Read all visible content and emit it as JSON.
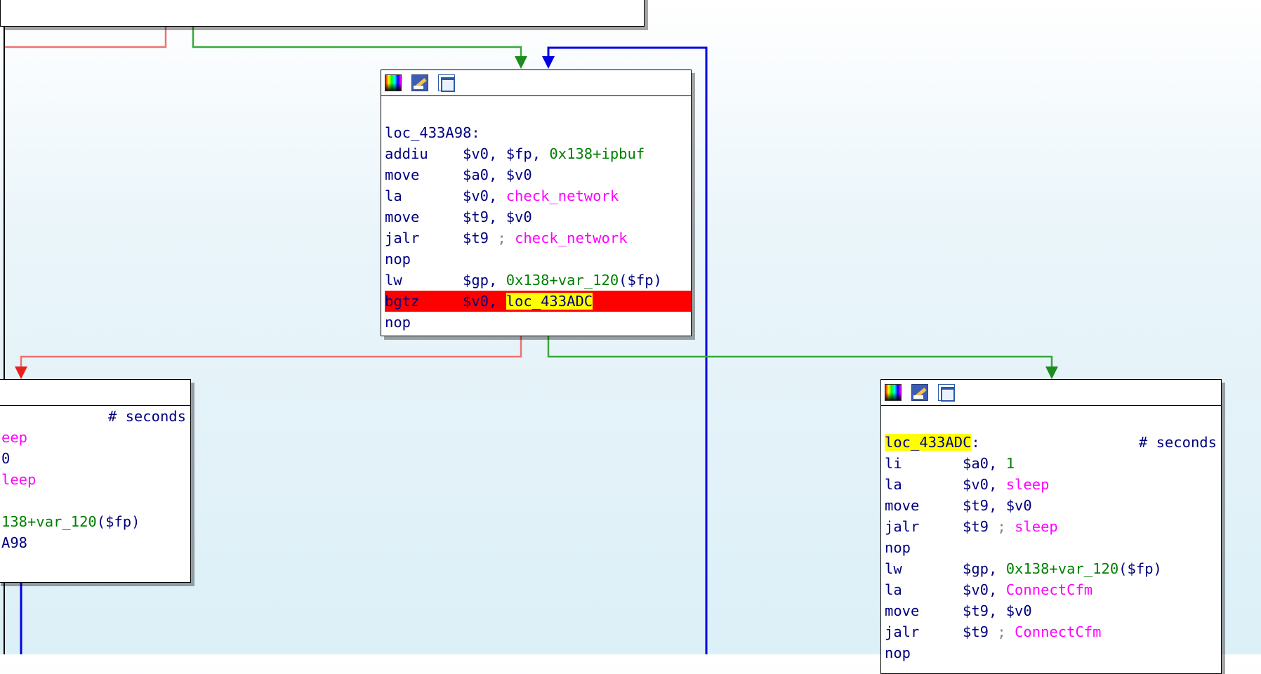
{
  "nodes": {
    "center": {
      "lines": [
        {
          "label": "loc_433A98:"
        },
        {
          "op": "addiu",
          "args": [
            {
              "t": "$v0, $fp, ",
              "c": "navy"
            },
            {
              "t": "0x138+ipbuf",
              "c": "grn"
            }
          ]
        },
        {
          "op": "move",
          "args": [
            {
              "t": "$a0, $v0",
              "c": "navy"
            }
          ]
        },
        {
          "op": "la",
          "args": [
            {
              "t": "$v0, ",
              "c": "navy"
            },
            {
              "t": "check_network",
              "c": "mag"
            }
          ]
        },
        {
          "op": "move",
          "args": [
            {
              "t": "$t9, $v0",
              "c": "navy"
            }
          ]
        },
        {
          "op": "jalr",
          "args": [
            {
              "t": "$t9 ",
              "c": "navy"
            },
            {
              "t": "; ",
              "c": "gray"
            },
            {
              "t": "check_network",
              "c": "mag"
            }
          ]
        },
        {
          "op": "nop",
          "args": []
        },
        {
          "op": "lw",
          "args": [
            {
              "t": "$gp, ",
              "c": "navy"
            },
            {
              "t": "0x138+var_120",
              "c": "grn"
            },
            {
              "t": "($fp)",
              "c": "navy"
            }
          ]
        },
        {
          "op": "bgtz",
          "args": [
            {
              "t": "$v0, ",
              "c": "navy"
            },
            {
              "t": "loc_433ADC",
              "c": "hl-yellow"
            }
          ],
          "highlight": true
        },
        {
          "op": "nop",
          "args": []
        }
      ]
    },
    "right": {
      "comment": "# seconds",
      "lines": [
        {
          "label_hl": "loc_433ADC",
          "label_suffix": ":"
        },
        {
          "op": "li",
          "args": [
            {
              "t": "$a0, ",
              "c": "navy"
            },
            {
              "t": "1",
              "c": "grn"
            }
          ]
        },
        {
          "op": "la",
          "args": [
            {
              "t": "$v0, ",
              "c": "navy"
            },
            {
              "t": "sleep",
              "c": "mag"
            }
          ]
        },
        {
          "op": "move",
          "args": [
            {
              "t": "$t9, $v0",
              "c": "navy"
            }
          ]
        },
        {
          "op": "jalr",
          "args": [
            {
              "t": "$t9 ",
              "c": "navy"
            },
            {
              "t": "; ",
              "c": "gray"
            },
            {
              "t": "sleep",
              "c": "mag"
            }
          ]
        },
        {
          "op": "nop",
          "args": []
        },
        {
          "op": "lw",
          "args": [
            {
              "t": "$gp, ",
              "c": "navy"
            },
            {
              "t": "0x138+var_120",
              "c": "grn"
            },
            {
              "t": "($fp)",
              "c": "navy"
            }
          ]
        },
        {
          "op": "la",
          "args": [
            {
              "t": "$v0, ",
              "c": "navy"
            },
            {
              "t": "ConnectCfm",
              "c": "mag"
            }
          ]
        },
        {
          "op": "move",
          "args": [
            {
              "t": "$t9, $v0",
              "c": "navy"
            }
          ]
        },
        {
          "op": "jalr",
          "args": [
            {
              "t": "$t9 ",
              "c": "navy"
            },
            {
              "t": "; ",
              "c": "gray"
            },
            {
              "t": "ConnectCfm",
              "c": "mag"
            }
          ]
        },
        {
          "op": "nop",
          "args": []
        }
      ]
    },
    "left": {
      "comment": "# seconds",
      "fragments": [
        {
          "parts": [
            {
              "t": "eep",
              "c": "mag"
            }
          ]
        },
        {
          "parts": [
            {
              "t": "0",
              "c": "navy"
            }
          ]
        },
        {
          "parts": [
            {
              "t": "leep",
              "c": "mag"
            }
          ]
        },
        {
          "parts": []
        },
        {
          "parts": [
            {
              "t": "138+var_120",
              "c": "grn"
            },
            {
              "t": "($fp)",
              "c": "navy"
            }
          ]
        },
        {
          "parts": [
            {
              "t": "A98",
              "c": "navy"
            }
          ]
        }
      ]
    }
  },
  "colors": {
    "edge_true": "#1e8c1e",
    "edge_false": "#f07070",
    "edge_loop": "#0000ff",
    "highlight_line": "#ff0000",
    "highlight_label": "#ffff00"
  }
}
